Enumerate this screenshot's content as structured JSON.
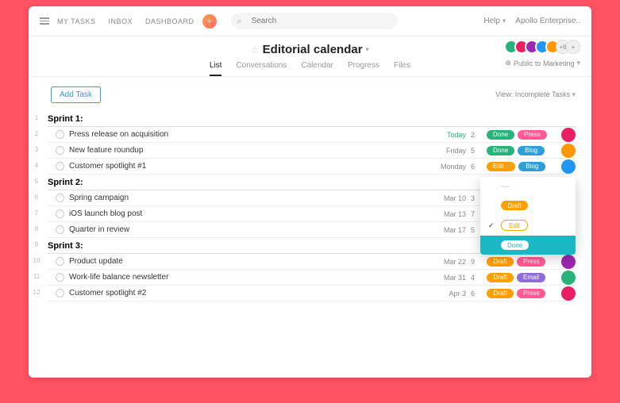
{
  "nav": {
    "mytasks": "MY TASKS",
    "inbox": "INBOX",
    "dashboard": "DASHBOARD"
  },
  "search": {
    "placeholder": "Search"
  },
  "help": "Help",
  "workspace": "Apollo Enterprise..",
  "title": "Editorial calendar",
  "tabs": {
    "list": "List",
    "conversations": "Conversations",
    "calendar": "Calendar",
    "progress": "Progress",
    "files": "Files"
  },
  "privacy": "Public to Marketing",
  "avatar_more": "+6",
  "toolbar": {
    "add_task": "Add Task",
    "view": "View: Incomplete Tasks"
  },
  "colors": {
    "done": "#2ab27b",
    "press": "#ff5c93",
    "blog": "#2e9fd8",
    "edit": "#ffa000",
    "draft": "#ffa000",
    "email": "#8e6dd7",
    "av0": "#2ab27b",
    "av1": "#e91e63",
    "av2": "#9c27b0",
    "av3": "#2196f3",
    "av4": "#ff9800",
    "row_av": [
      "#e91e63",
      "#ff9800",
      "#2196f3",
      "#9c27b0",
      "#2ab27b",
      "#e91e63",
      "#ff9800",
      "#2196f3",
      "#9c27b0"
    ]
  },
  "sections": [
    {
      "title": "Sprint 1:",
      "rownum": "1",
      "tasks": [
        {
          "rownum": "2",
          "name": "Press release on acquisition",
          "due": "Today",
          "due_today": true,
          "count": "2",
          "pills": [
            {
              "t": "Done",
              "c": "#2ab27b"
            },
            {
              "t": "Press",
              "c": "#ff5c93"
            }
          ],
          "av": "#e91e63"
        },
        {
          "rownum": "3",
          "name": "New feature roundup",
          "due": "Friday",
          "count": "5",
          "pills": [
            {
              "t": "Done",
              "c": "#2ab27b"
            },
            {
              "t": "Blog",
              "c": "#2e9fd8"
            }
          ],
          "av": "#ff9800"
        },
        {
          "rownum": "4",
          "name": "Customer spotlight #1",
          "due": "Monday",
          "count": "6",
          "pills": [
            {
              "t": "Edit",
              "c": "#ffa000",
              "drop": true
            },
            {
              "t": "Blog",
              "c": "#2e9fd8"
            }
          ],
          "av": "#2196f3"
        }
      ]
    },
    {
      "title": "Sprint 2:",
      "rownum": "5",
      "tasks": [
        {
          "rownum": "6",
          "name": "Spring campaign",
          "due": "Mar 10",
          "count": "3",
          "pills": [],
          "av": ""
        },
        {
          "rownum": "7",
          "name": "iOS launch blog post",
          "due": "Mar 13",
          "count": "7",
          "pills": [],
          "av": ""
        },
        {
          "rownum": "8",
          "name": "Quarter in review",
          "due": "Mar 17",
          "count": "5",
          "pills": [],
          "av": ""
        }
      ]
    },
    {
      "title": "Sprint 3:",
      "rownum": "9",
      "tasks": [
        {
          "rownum": "10",
          "name": "Product update",
          "due": "Mar 22",
          "count": "9",
          "pills": [
            {
              "t": "Draft",
              "c": "#ffa000"
            },
            {
              "t": "Press",
              "c": "#ff5c93"
            }
          ],
          "av": "#9c27b0"
        },
        {
          "rownum": "11",
          "name": "Work-life balance newsletter",
          "due": "Mar 31",
          "count": "4",
          "pills": [
            {
              "t": "Draft",
              "c": "#ffa000"
            },
            {
              "t": "Email",
              "c": "#8e6dd7"
            }
          ],
          "av": "#2ab27b"
        },
        {
          "rownum": "12",
          "name": "Customer spotlight #2",
          "due": "Apr 3",
          "count": "6",
          "pills": [
            {
              "t": "Draft",
              "c": "#ffa000"
            },
            {
              "t": "Press",
              "c": "#ff5c93"
            }
          ],
          "av": "#e91e63"
        }
      ]
    }
  ],
  "dropdown": {
    "blank": "—",
    "items": [
      {
        "label": "Draft",
        "color": "#ffa000",
        "checked": false
      },
      {
        "label": "Edit",
        "color": "#ffa000",
        "checked": true,
        "outline": true
      },
      {
        "label": "Done",
        "color": "#1bb8c4",
        "checked": false,
        "highlight": true
      }
    ]
  }
}
